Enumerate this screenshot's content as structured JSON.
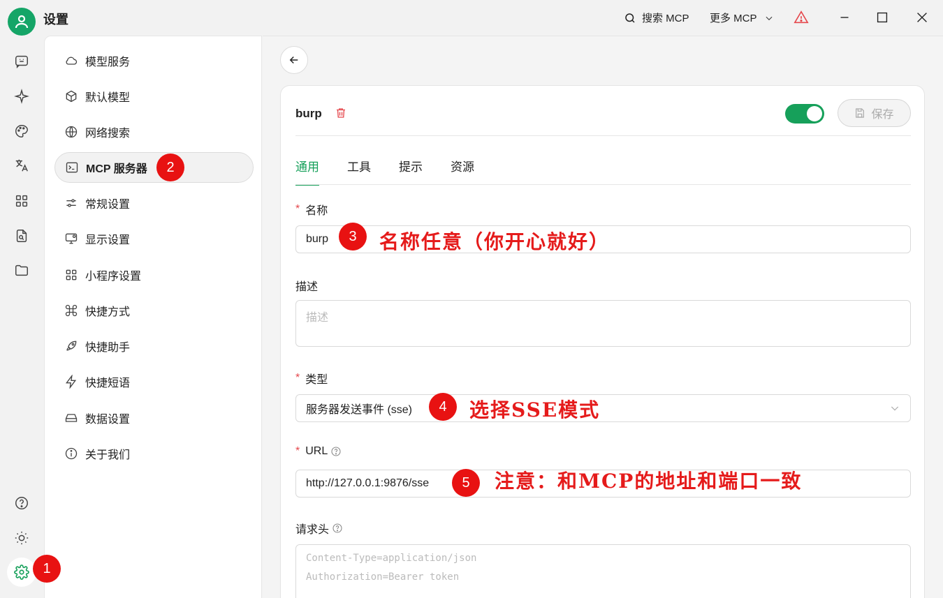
{
  "window": {
    "title": "设置",
    "search_label": "搜索 MCP",
    "more_label": "更多 MCP"
  },
  "colors": {
    "accent": "#16a05a",
    "annotation": "#e51b1b",
    "badge": "#e81212"
  },
  "rail": {
    "icons": [
      "chat-icon",
      "sparkle-icon",
      "palette-icon",
      "translate-icon",
      "apps-grid-icon",
      "file-search-icon",
      "folder-icon",
      "help-icon",
      "theme-icon",
      "settings-icon"
    ]
  },
  "menu": {
    "items": [
      {
        "label": "模型服务",
        "icon": "cloud-icon"
      },
      {
        "label": "默认模型",
        "icon": "cube-icon"
      },
      {
        "label": "网络搜索",
        "icon": "globe-icon"
      },
      {
        "label": "MCP 服务器",
        "icon": "terminal-icon"
      },
      {
        "label": "常规设置",
        "icon": "sliders-icon"
      },
      {
        "label": "显示设置",
        "icon": "monitor-icon"
      },
      {
        "label": "小程序设置",
        "icon": "grid-icon"
      },
      {
        "label": "快捷方式",
        "icon": "command-icon"
      },
      {
        "label": "快捷助手",
        "icon": "rocket-icon"
      },
      {
        "label": "快捷短语",
        "icon": "zap-icon"
      },
      {
        "label": "数据设置",
        "icon": "hard-drive-icon"
      },
      {
        "label": "关于我们",
        "icon": "info-icon"
      }
    ]
  },
  "server": {
    "name": "burp",
    "enabled": true,
    "save_label": "保存",
    "tabs": [
      "通用",
      "工具",
      "提示",
      "资源"
    ],
    "fields": {
      "name_label": "名称",
      "name_value": "burp",
      "desc_label": "描述",
      "desc_placeholder": "描述",
      "type_label": "类型",
      "type_value": "服务器发送事件 (sse)",
      "url_label": "URL",
      "url_value": "http://127.0.0.1:9876/sse",
      "headers_label": "请求头",
      "headers_placeholder_1": "Content-Type=application/json",
      "headers_placeholder_2": "Authorization=Bearer token"
    }
  },
  "annotations": {
    "badges": [
      "1",
      "2",
      "3",
      "4",
      "5"
    ],
    "name_note": "名称任意（你开心就好）",
    "type_note": "选择SSE模式",
    "url_note": "注意：和MCP的地址和端口一致"
  }
}
